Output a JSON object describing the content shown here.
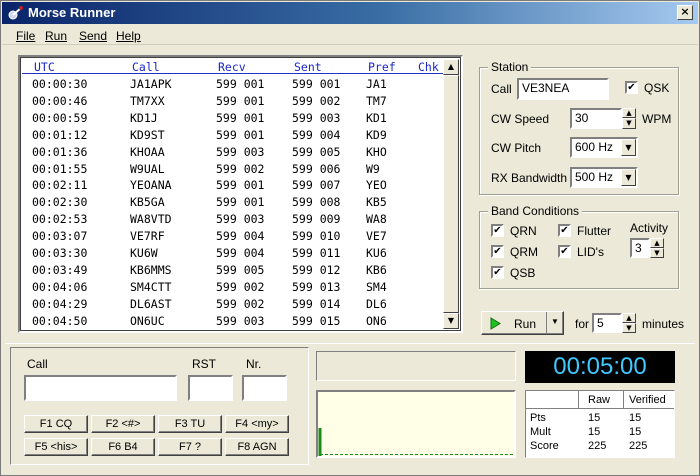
{
  "window": {
    "title": "Morse Runner",
    "close_glyph": "×"
  },
  "menu": [
    "File",
    "Run",
    "Send",
    "Help"
  ],
  "log": {
    "columns": [
      "UTC",
      "Call",
      "Recv",
      "Sent",
      "Pref",
      "Chk"
    ],
    "rows": [
      [
        "00:00:30",
        "JA1APK",
        "599 001",
        "599 001",
        "JA1"
      ],
      [
        "00:00:46",
        "TM7XX",
        "599 001",
        "599 002",
        "TM7"
      ],
      [
        "00:00:59",
        "KD1J",
        "599 001",
        "599 003",
        "KD1"
      ],
      [
        "00:01:12",
        "KD9ST",
        "599 001",
        "599 004",
        "KD9"
      ],
      [
        "00:01:36",
        "KHOAA",
        "599 003",
        "599 005",
        "KHO"
      ],
      [
        "00:01:55",
        "W9UAL",
        "599 002",
        "599 006",
        "W9"
      ],
      [
        "00:02:11",
        "YEOANA",
        "599 001",
        "599 007",
        "YEO"
      ],
      [
        "00:02:30",
        "KB5GA",
        "599 001",
        "599 008",
        "KB5"
      ],
      [
        "00:02:53",
        "WA8VTD",
        "599 003",
        "599 009",
        "WA8"
      ],
      [
        "00:03:07",
        "VE7RF",
        "599 004",
        "599 010",
        "VE7"
      ],
      [
        "00:03:30",
        "KU6W",
        "599 004",
        "599 011",
        "KU6"
      ],
      [
        "00:03:49",
        "KB6MMS",
        "599 005",
        "599 012",
        "KB6"
      ],
      [
        "00:04:06",
        "SM4CTT",
        "599 002",
        "599 013",
        "SM4"
      ],
      [
        "00:04:29",
        "DL6AST",
        "599 002",
        "599 014",
        "DL6"
      ],
      [
        "00:04:50",
        "ON6UC",
        "599 003",
        "599 015",
        "ON6"
      ]
    ]
  },
  "station": {
    "group_label": "Station",
    "call_label": "Call",
    "call_value": "VE3NEA",
    "qsk_label": "QSK",
    "qsk_checked": true,
    "cw_speed_label": "CW Speed",
    "cw_speed_value": "30",
    "wpm_label": "WPM",
    "cw_pitch_label": "CW Pitch",
    "cw_pitch_value": "600 Hz",
    "rx_bw_label": "RX Bandwidth",
    "rx_bw_value": "500 Hz"
  },
  "band": {
    "group_label": "Band Conditions",
    "qrn": "QRN",
    "qrm": "QRM",
    "qsb": "QSB",
    "flutter": "Flutter",
    "lids": "LID's",
    "activity_label": "Activity",
    "activity_value": "3",
    "check_glyph": "✔"
  },
  "run": {
    "run_label": "Run",
    "for_label": "for",
    "minutes_value": "5",
    "minutes_label": "minutes"
  },
  "entry": {
    "call_label": "Call",
    "rst_label": "RST",
    "nr_label": "Nr.",
    "call_value": "",
    "rst_value": "",
    "nr_value": ""
  },
  "fkeys": [
    "F1 CQ",
    "F2 <#>",
    "F3 TU",
    "F4 <my>",
    "F5 <his>",
    "F6 B4",
    "F7 ?",
    "F8 AGN"
  ],
  "clock": "00:05:00",
  "score": {
    "headers": [
      "Raw",
      "Verified"
    ],
    "rows": [
      [
        "Pts",
        "15",
        "15"
      ],
      [
        "Mult",
        "15",
        "15"
      ],
      [
        "Score",
        "225",
        "225"
      ]
    ]
  },
  "colors": {
    "accent": "#1a28c8",
    "clock_text": "#3ec9ff",
    "spectrum_line": "#1a8a1a"
  }
}
